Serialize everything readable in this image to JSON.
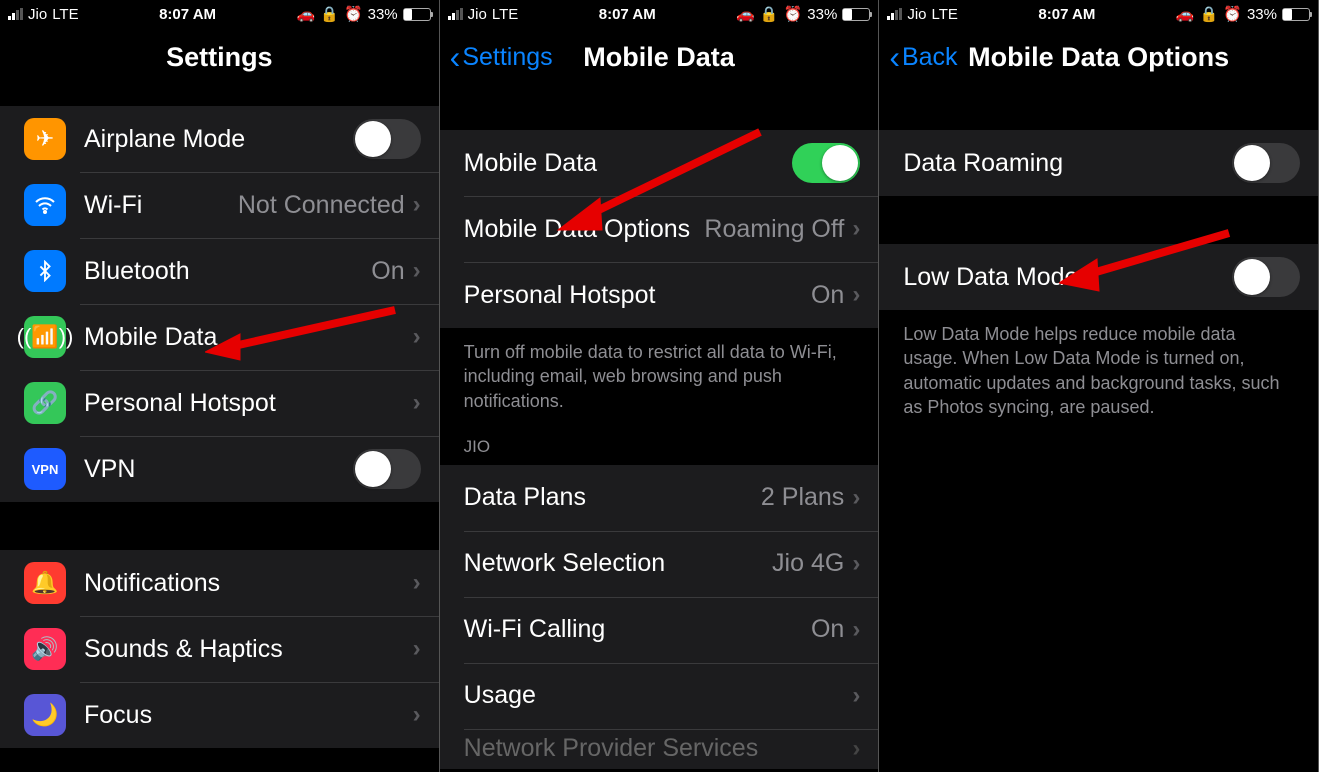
{
  "status": {
    "carrier": "Jio",
    "network": "LTE",
    "time": "8:07 AM",
    "battery_pct": "33%"
  },
  "screen1": {
    "title": "Settings",
    "rows": {
      "airplane": "Airplane Mode",
      "wifi": "Wi-Fi",
      "wifi_value": "Not Connected",
      "bluetooth": "Bluetooth",
      "bluetooth_value": "On",
      "mobile_data": "Mobile Data",
      "personal_hotspot": "Personal Hotspot",
      "vpn": "VPN",
      "notifications": "Notifications",
      "sounds": "Sounds & Haptics",
      "focus": "Focus"
    }
  },
  "screen2": {
    "back": "Settings",
    "title": "Mobile Data",
    "rows": {
      "mobile_data": "Mobile Data",
      "mobile_data_options": "Mobile Data Options",
      "mobile_data_options_value": "Roaming Off",
      "personal_hotspot": "Personal Hotspot",
      "personal_hotspot_value": "On"
    },
    "footer1": "Turn off mobile data to restrict all data to Wi-Fi, including email, web browsing and push notifications.",
    "header2": "JIO",
    "rows2": {
      "data_plans": "Data Plans",
      "data_plans_value": "2 Plans",
      "network_selection": "Network Selection",
      "network_selection_value": "Jio 4G",
      "wifi_calling": "Wi-Fi Calling",
      "wifi_calling_value": "On",
      "usage": "Usage",
      "network_provider": "Network Provider Services"
    }
  },
  "screen3": {
    "back": "Back",
    "title": "Mobile Data Options",
    "rows": {
      "data_roaming": "Data Roaming",
      "low_data_mode": "Low Data Mode"
    },
    "footer": "Low Data Mode helps reduce mobile data usage. When Low Data Mode is turned on, automatic updates and background tasks, such as Photos syncing, are paused."
  }
}
